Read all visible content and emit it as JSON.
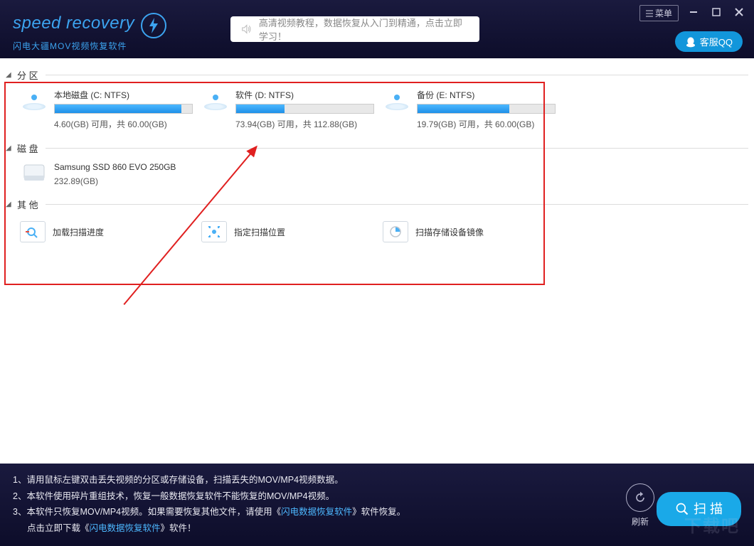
{
  "header": {
    "logo_text": "speed recovery",
    "logo_sub": "闪电大疆MOV视频恢复软件",
    "tutorial_text": "高清视频教程，数据恢复从入门到精通，点击立即学习！",
    "menu_label": "菜单",
    "qq_label": "客服QQ"
  },
  "sections": {
    "partition_title": "分 区",
    "disk_title": "磁 盘",
    "other_title": "其 他"
  },
  "partitions": [
    {
      "name": "本地磁盘 (C: NTFS)",
      "usage": "4.60(GB) 可用，共 60.00(GB)",
      "fill_pct": 92
    },
    {
      "name": "软件 (D: NTFS)",
      "usage": "73.94(GB) 可用，共 112.88(GB)",
      "fill_pct": 35
    },
    {
      "name": "备份 (E: NTFS)",
      "usage": "19.79(GB) 可用，共 60.00(GB)",
      "fill_pct": 67
    }
  ],
  "disks": [
    {
      "name": "Samsung SSD 860 EVO 250GB",
      "size": "232.89(GB)"
    }
  ],
  "others": [
    {
      "label": "加载扫描进度"
    },
    {
      "label": "指定扫描位置"
    },
    {
      "label": "扫描存储设备镜像"
    }
  ],
  "footer": {
    "line1_a": "1、请用鼠标左键双击丢失视频的分区或存储设备，扫描丢失的MOV/MP4视频数据。",
    "line2_a": "2、本软件使用碎片重组技术，恢复一般数据恢复软件不能恢复的MOV/MP4视频。",
    "line3_a": "3、本软件只恢复MOV/MP4视频。如果需要恢复其他文件，请使用《",
    "line3_link": "闪电数据恢复软件",
    "line3_b": "》软件恢复。",
    "line4_a": "点击立即下载《",
    "line4_link": "闪电数据恢复软件",
    "line4_b": "》软件！",
    "refresh_label": "刷新",
    "scan_label": "扫 描"
  },
  "colors": {
    "accent": "#1aa9e8",
    "danger": "#e02020"
  }
}
